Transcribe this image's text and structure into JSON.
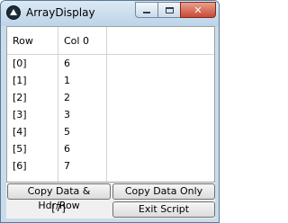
{
  "window": {
    "title": "ArrayDisplay",
    "min_glyph": "",
    "close_glyph": "✕"
  },
  "table": {
    "headers": [
      "Row",
      "Col 0"
    ],
    "rows": [
      [
        "[0]",
        "6"
      ],
      [
        "[1]",
        "1"
      ],
      [
        "[2]",
        "2"
      ],
      [
        "[3]",
        "3"
      ],
      [
        "[4]",
        "5"
      ],
      [
        "[5]",
        "6"
      ],
      [
        "[6]",
        "7"
      ]
    ]
  },
  "buttons": {
    "copy_data_hdr_row": "Copy Data & Hdr/Row",
    "copy_data_only": "Copy Data Only",
    "exit_script": "Exit Script"
  },
  "status": {
    "row_count": "[7]"
  },
  "icons": {
    "app": "app-icon",
    "minimize": "minimize-icon",
    "maximize": "maximize-icon",
    "close": "close-icon"
  }
}
